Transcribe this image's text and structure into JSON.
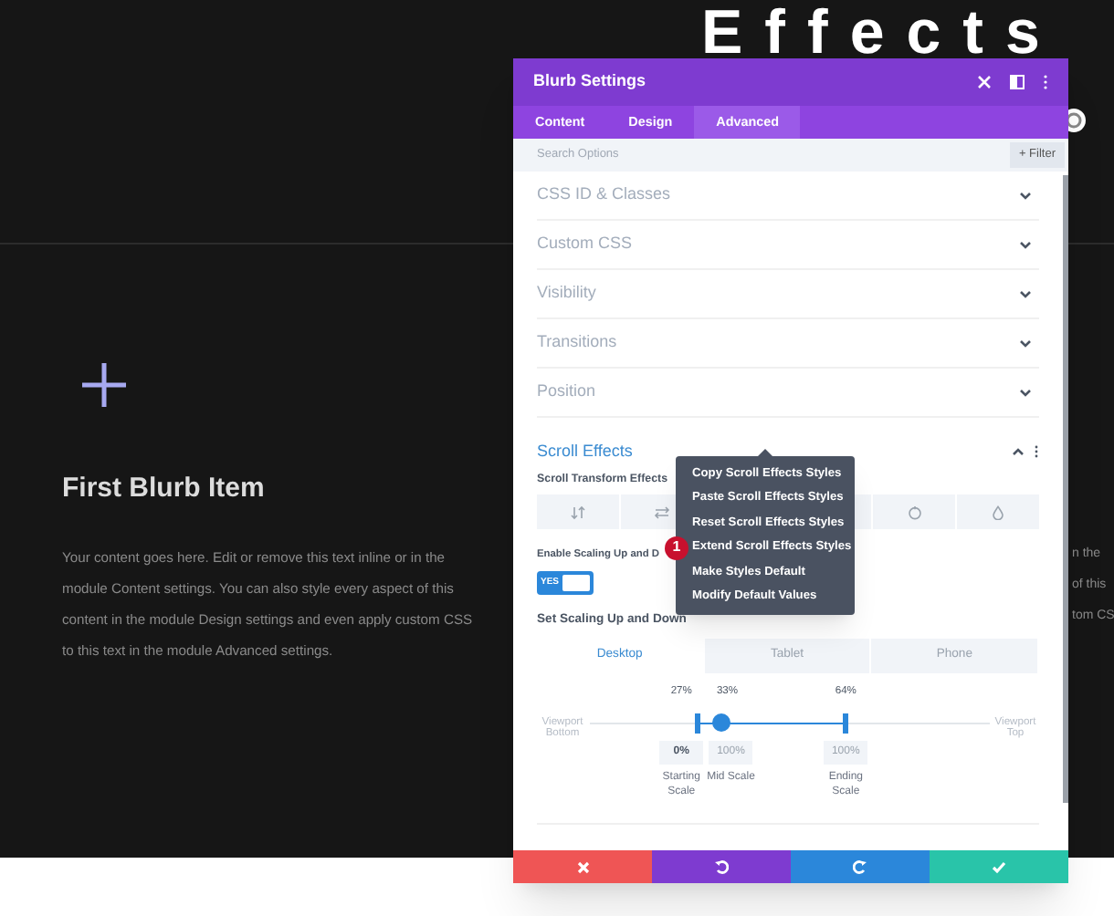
{
  "page": {
    "heading": "Effects",
    "blurb": {
      "title": "First Blurb Item",
      "text": "Your content goes here. Edit or remove this text inline or in the module Content settings. You can also style every aspect of this content in the module Design settings and even apply custom CSS to this text in the module Advanced settings."
    },
    "right_text": [
      "n the",
      "of this",
      "tom CS"
    ]
  },
  "modal": {
    "title": "Blurb Settings",
    "tabs": [
      {
        "label": "Content",
        "selected": false
      },
      {
        "label": "Design",
        "selected": false
      },
      {
        "label": "Advanced",
        "selected": true
      }
    ],
    "search": {
      "placeholder": "Search Options"
    },
    "filter_button": "+ Filter",
    "sections": [
      {
        "title": "CSS ID & Classes",
        "expanded": false
      },
      {
        "title": "Custom CSS",
        "expanded": false
      },
      {
        "title": "Visibility",
        "expanded": false
      },
      {
        "title": "Transitions",
        "expanded": false
      },
      {
        "title": "Position",
        "expanded": false
      },
      {
        "title": "Scroll Effects",
        "expanded": true
      }
    ],
    "scroll_effects": {
      "transform_label": "Scroll Transform Effects",
      "enable_label": "Enable Scaling Up and D",
      "toggle": {
        "label": "YES",
        "on": true
      },
      "set_label": "Set Scaling Up and Down",
      "devices": [
        {
          "label": "Desktop",
          "selected": true
        },
        {
          "label": "Tablet",
          "selected": false
        },
        {
          "label": "Phone",
          "selected": false
        }
      ],
      "viewport_bottom": "Viewport Bottom",
      "viewport_top": "Viewport Top",
      "markers": [
        {
          "reading": "27%",
          "level": 0.27,
          "kind": "bar"
        },
        {
          "reading": "33%",
          "level": 0.33,
          "kind": "dot"
        },
        {
          "reading": "64%",
          "level": 0.64,
          "kind": "bar"
        }
      ],
      "values": [
        {
          "value": "0%",
          "label": "Starting Scale",
          "active": true
        },
        {
          "value": "100%",
          "label": "Mid Scale",
          "active": false
        },
        {
          "value": "100%",
          "label": "Ending Scale",
          "active": false
        }
      ]
    },
    "context_menu": {
      "items": [
        {
          "label": "Copy Scroll Effects Styles"
        },
        {
          "label": "Paste Scroll Effects Styles"
        },
        {
          "label": "Reset Scroll Effects Styles"
        },
        {
          "label": "Extend Scroll Effects Styles",
          "badge": "1"
        },
        {
          "label": "Make Styles Default"
        },
        {
          "label": "Modify Default Values"
        }
      ]
    },
    "footer_buttons": [
      {
        "kind": "cancel"
      },
      {
        "kind": "undo"
      },
      {
        "kind": "redo"
      },
      {
        "kind": "save"
      }
    ]
  }
}
